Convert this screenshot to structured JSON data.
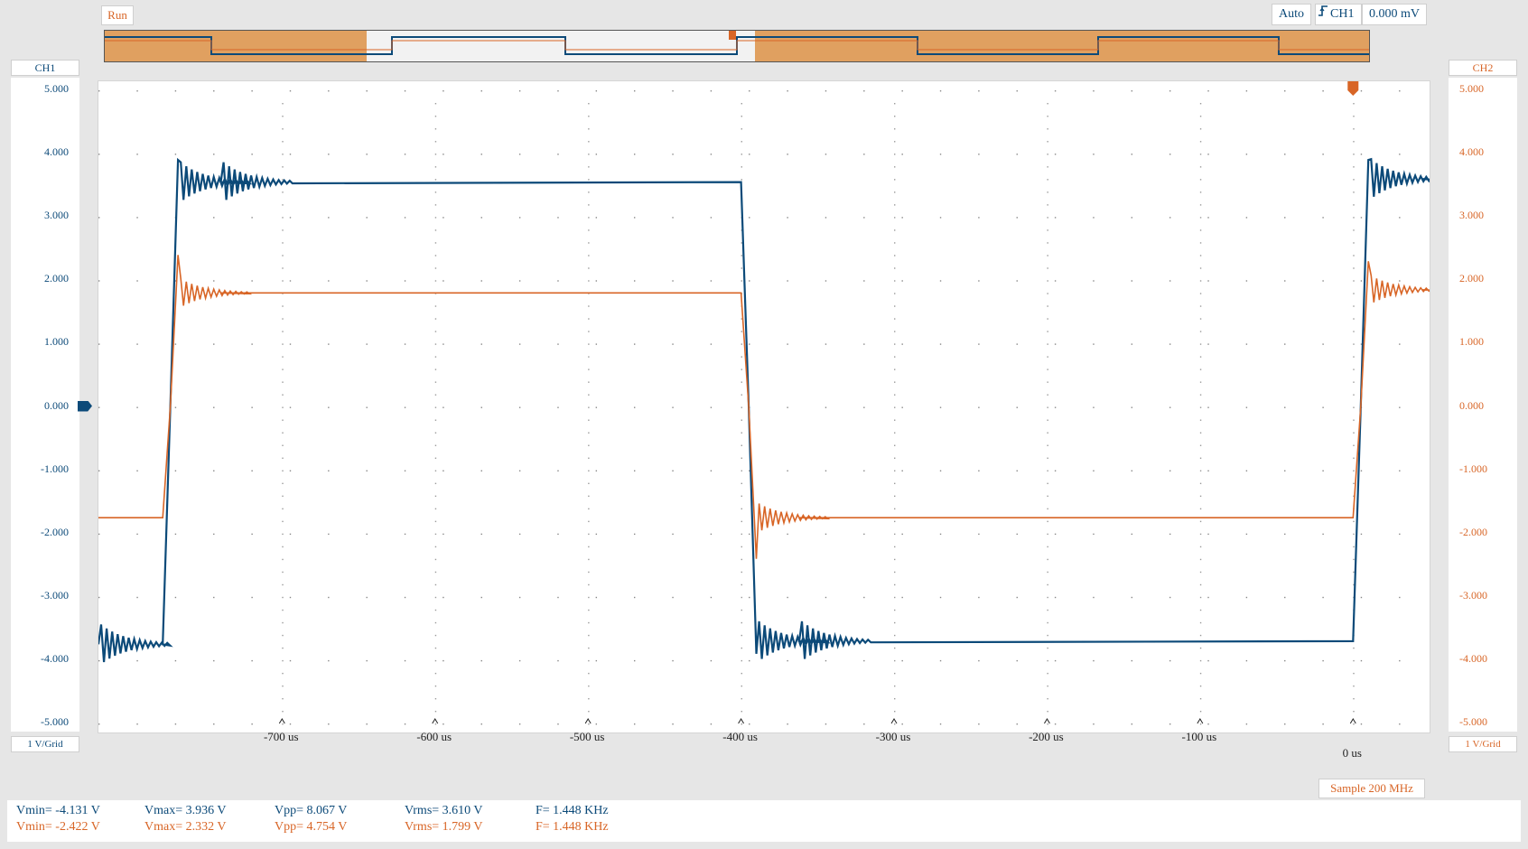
{
  "toolbar": {
    "run_label": "Run",
    "trigger_mode": "Auto",
    "trigger_source": "CH1",
    "trigger_level": "0.000 mV"
  },
  "ch1": {
    "label": "CH1",
    "scale": "1 V/Grid",
    "color": "#0c4a79",
    "ticks": [
      "5.000",
      "4.000",
      "3.000",
      "2.000",
      "1.000",
      "0.000",
      "-1.000",
      "-2.000",
      "-3.000",
      "-4.000",
      "-5.000"
    ]
  },
  "ch2": {
    "label": "CH2",
    "scale": "1 V/Grid",
    "color": "#d86526",
    "ticks": [
      "5.000",
      "4.000",
      "3.000",
      "2.000",
      "1.000",
      "0.000",
      "-1.000",
      "-2.000",
      "-3.000",
      "-4.000",
      "-5.000"
    ]
  },
  "time_axis": {
    "ticks": [
      "-700 us",
      "-600 us",
      "-500 us",
      "-400 us",
      "-300 us",
      "-200 us",
      "-100 us",
      "0 us"
    ]
  },
  "acquisition": {
    "sample_rate": "Sample 200 MHz"
  },
  "measurements": {
    "ch1": {
      "vmin": "Vmin= -4.131 V",
      "vmax": "Vmax= 3.936 V",
      "vpp": "Vpp= 8.067 V",
      "vrms": "Vrms= 3.610 V",
      "freq": "F= 1.448 KHz"
    },
    "ch2": {
      "vmin": "Vmin= -2.422 V",
      "vmax": "Vmax= 2.332 V",
      "vpp": "Vpp= 4.754 V",
      "vrms": "Vrms= 1.799 V",
      "freq": "F= 1.448 KHz"
    }
  },
  "chart_data": {
    "type": "line",
    "xlabel": "",
    "ylabel": "",
    "xlim": [
      -820,
      50
    ],
    "ylim": [
      -5,
      5
    ],
    "grid": true,
    "series": [
      {
        "name": "CH1",
        "color": "#0c4a79",
        "x": [
          -820,
          -778,
          -773,
          -768,
          -740,
          -400,
          -395,
          -390,
          -362,
          0,
          5,
          10,
          45
        ],
        "values": [
          -3.75,
          -3.75,
          0.0,
          3.9,
          3.55,
          3.55,
          0.0,
          -3.9,
          -3.7,
          -3.7,
          0.0,
          3.9,
          3.6
        ]
      },
      {
        "name": "CH2",
        "color": "#d86526",
        "x": [
          -820,
          -778,
          -773,
          -768,
          -740,
          -400,
          -395,
          -390,
          -362,
          0,
          5,
          10,
          45
        ],
        "values": [
          -1.75,
          -1.75,
          0.0,
          2.4,
          1.8,
          1.8,
          0.0,
          -2.4,
          -1.75,
          -1.75,
          0.0,
          2.3,
          1.85
        ]
      }
    ]
  }
}
